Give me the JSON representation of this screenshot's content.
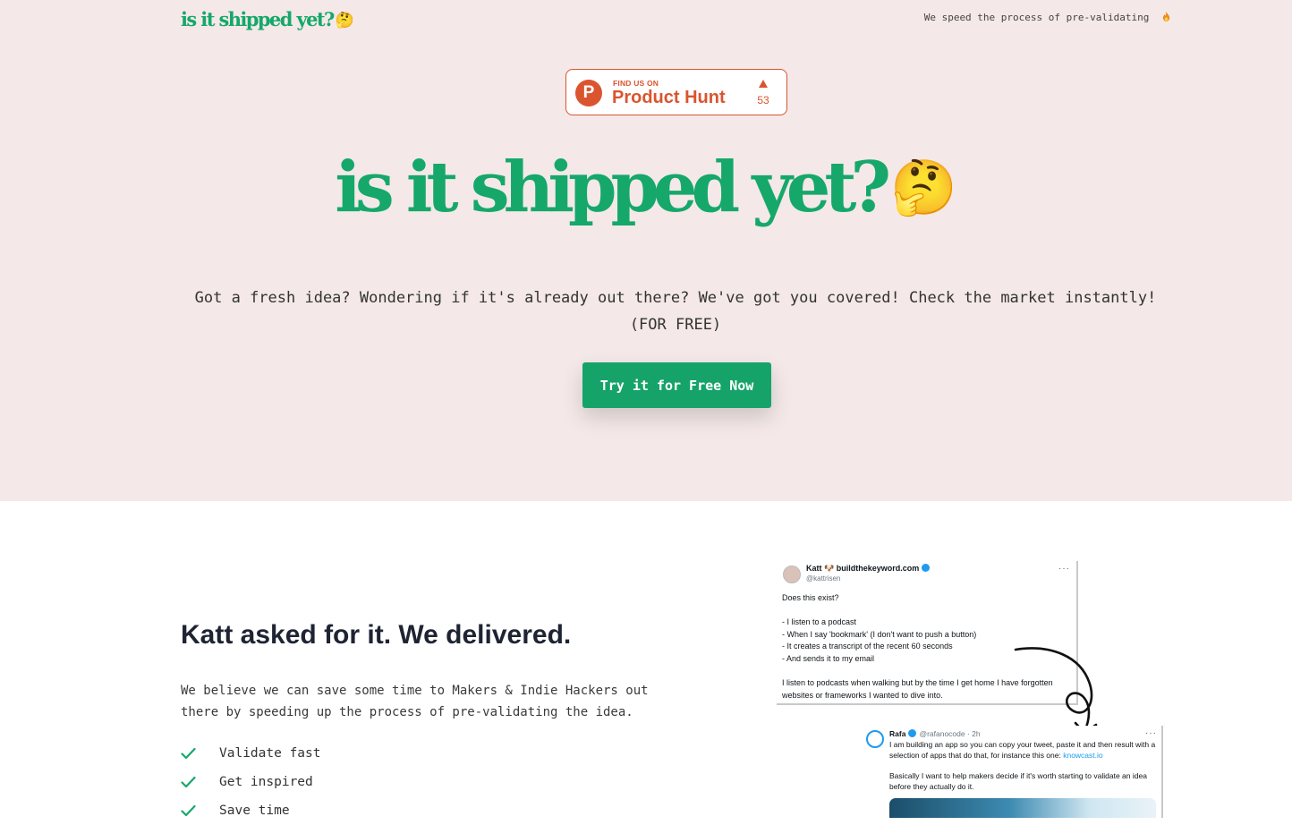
{
  "header": {
    "logo_text": "is it shipped yet?",
    "logo_emoji": "🤔",
    "tagline": "We speed the process of pre-validating",
    "tagline_icon": "flame-icon"
  },
  "product_hunt": {
    "small_label": "FIND US ON",
    "big_label": "Product Hunt",
    "logo_letter": "P",
    "upvotes": "53",
    "color": "#da552f"
  },
  "hero": {
    "title": "is it shipped yet?",
    "emoji": "🤔",
    "subtitle": "Got a fresh idea? Wondering if it's already out there? We've got you covered! Check the market instantly! (FOR FREE)",
    "cta_label": "Try it for Free Now"
  },
  "section": {
    "title": "Katt asked for it. We delivered.",
    "body": "We believe we can save some time to Makers & Indie Hackers out there by speeding up the process of pre-validating the idea.",
    "features": [
      "Validate fast",
      "Get inspired",
      "Save time"
    ]
  },
  "tweets": {
    "first": {
      "name": "Katt 🐶 buildthekeyword.com",
      "handle": "@kattrisen",
      "text": "Does this exist?\n\n- I listen to a podcast\n- When I say 'bookmark' (I don't want to push a button)\n- It creates a transcript of the recent 60 seconds\n- And sends it to my email\n\nI listen to podcasts when walking but by the time I get home I have forgotten websites or frameworks I wanted to dive into."
    },
    "second": {
      "name": "Rafa",
      "handle": "@rafanocode · 2h",
      "text": "I am building an app so you can copy your tweet, paste it and then result with a selection of apps that do that, for instance this one:",
      "link": "knowcast.io",
      "text2": "Basically I want to help makers decide if it's worth starting to validate an idea before they actually do it."
    }
  },
  "colors": {
    "brand_green": "#15a86a",
    "hero_background": "#f4e8e8",
    "button_green": "#16a36a"
  }
}
